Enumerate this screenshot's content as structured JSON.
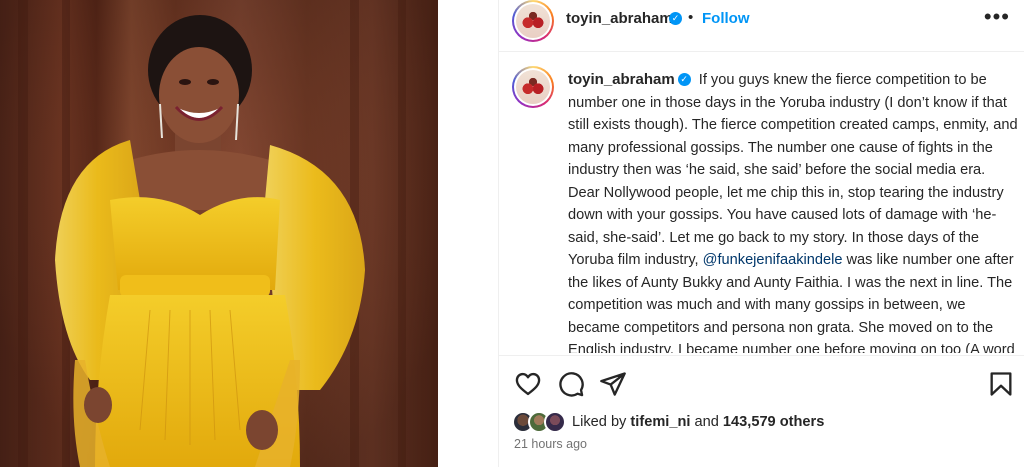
{
  "post": {
    "username": "toyin_abraham",
    "follow_label": "Follow",
    "dot": "•",
    "more_label": "•••",
    "verified_glyph": "✓",
    "caption_pre": "If you guys knew the fierce competition to be number one in those days in the Yoruba industry (I don’t know if that still exists though). The fierce competition created camps, enmity, and many professional gossips. The number one cause of fights in the industry then was ‘he said, she said’ before the social media era. Dear Nollywood people, let me chip this in, stop tearing the industry down with your gossips. You have caused lots of damage with ‘he-said, she-said’. Let me go back to my story. In those days of the Yoruba film industry,",
    "mention": "@funkejenifaakindele",
    "caption_post": "was like number one after the likes of Aunty Bukky and Aunty Faithia. I was the next in line. The competition was much and with many gossips in between, we became competitors and persona non grata. She moved on to the English industry, I became number one before moving on too (A word of advice to young actors of today, no one will be",
    "likes_prefix": "Liked by",
    "liked_by_user": "tifemi_ni",
    "likes_and": "and",
    "likes_count": "143,579 others",
    "timestamp": "21 hours ago"
  },
  "icons": {
    "like": "heart-outline-icon",
    "comment": "comment-bubble-icon",
    "share": "paper-plane-icon",
    "save": "bookmark-icon",
    "more": "more-dots-icon"
  },
  "colors": {
    "link_blue": "#0095f6",
    "mention": "#00376b",
    "muted": "#737373",
    "dress_yellow": "#f2c21b"
  }
}
